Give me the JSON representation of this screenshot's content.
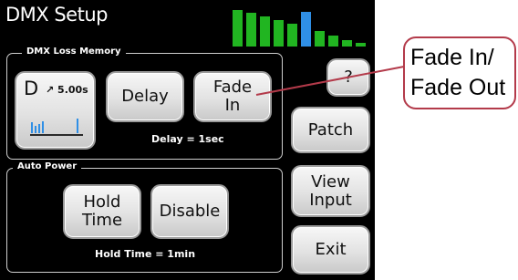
{
  "screen": {
    "title": "DMX Setup"
  },
  "signal_meter": {
    "colors": {
      "green": "#21b521",
      "blue": "#2f8fe6"
    },
    "levels": [
      1.0,
      0.93,
      0.82,
      0.72,
      0.63,
      0.95,
      0.43,
      0.3,
      0.18,
      0.1
    ]
  },
  "dmx_loss_memory": {
    "legend": "DMX Loss Memory",
    "mode_button": {
      "mode": "D",
      "rate": "↗ 5.00s"
    },
    "delay_label": "Delay",
    "fade_in_label": "Fade\nIn",
    "status": "Delay = 1sec"
  },
  "auto_power": {
    "legend": "Auto Power",
    "hold_time_label": "Hold\nTime",
    "disable_label": "Disable",
    "status": "Hold Time = 1min"
  },
  "side_buttons": {
    "help_label": "?",
    "patch_label": "Patch",
    "view_input_label": "View\nInput",
    "exit_label": "Exit"
  },
  "callout": {
    "line1": "Fade In/",
    "line2": "Fade Out"
  }
}
